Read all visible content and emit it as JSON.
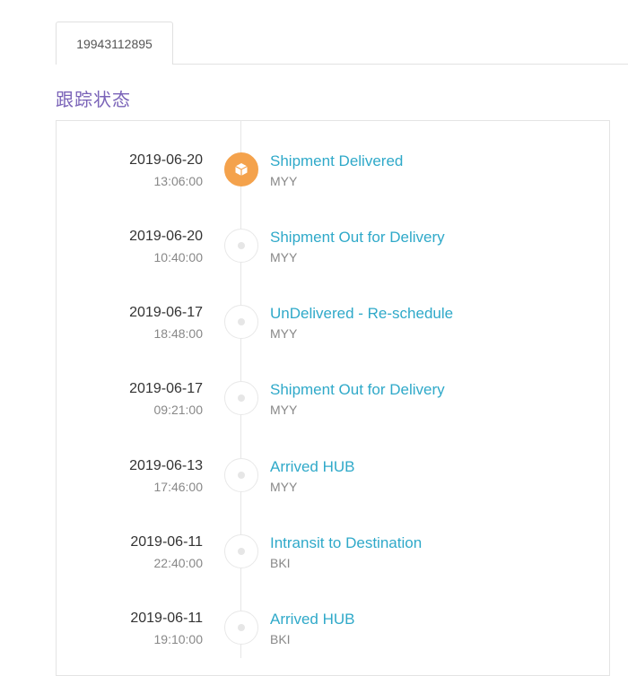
{
  "tabs": [
    {
      "label": "19943112895"
    }
  ],
  "section_title": "跟踪状态",
  "events": [
    {
      "date": "2019-06-20",
      "time": "13:06:00",
      "status": "Shipment Delivered",
      "location": "MYY",
      "active": true,
      "icon": "package-icon"
    },
    {
      "date": "2019-06-20",
      "time": "10:40:00",
      "status": "Shipment Out for Delivery",
      "location": "MYY",
      "active": false
    },
    {
      "date": "2019-06-17",
      "time": "18:48:00",
      "status": "UnDelivered - Re-schedule",
      "location": "MYY",
      "active": false
    },
    {
      "date": "2019-06-17",
      "time": "09:21:00",
      "status": "Shipment Out for Delivery",
      "location": "MYY",
      "active": false
    },
    {
      "date": "2019-06-13",
      "time": "17:46:00",
      "status": "Arrived HUB",
      "location": "MYY",
      "active": false
    },
    {
      "date": "2019-06-11",
      "time": "22:40:00",
      "status": "Intransit to Destination",
      "location": "BKI",
      "active": false
    },
    {
      "date": "2019-06-11",
      "time": "19:10:00",
      "status": "Arrived HUB",
      "location": "BKI",
      "active": false
    }
  ],
  "colors": {
    "accent_orange": "#f4a24c",
    "status_link": "#2fa9c9",
    "title_purple": "#7a63b8"
  }
}
